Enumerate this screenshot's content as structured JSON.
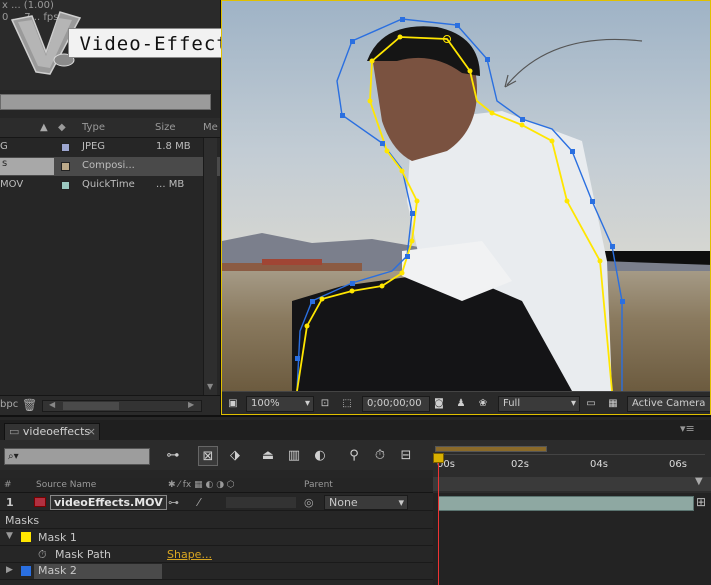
{
  "project_panel": {
    "info_lines": [
      "x ... (1.00)",
      "0 ... 7... fps"
    ],
    "columns": {
      "type": "Type",
      "size": "Size",
      "media": "Me"
    },
    "rows": [
      {
        "name": "G",
        "type": "JPEG",
        "size": "1.8 MB",
        "swatch": "#9da6cf",
        "selected": false
      },
      {
        "name": "s",
        "type": "Composi...",
        "size": "",
        "swatch": "#bca989",
        "selected": true
      },
      {
        "name": "MOV",
        "type": "QuickTime",
        "size": "... MB",
        "swatch": "#9bc7c0",
        "selected": false
      }
    ],
    "bottom_label": "bpc"
  },
  "logo": {
    "text": "Video-Effects.Ir"
  },
  "viewer": {
    "zoom": "100%",
    "timecode": "0;00;00;00",
    "resolution": "Full",
    "camera": "Active Camera"
  },
  "timeline": {
    "tab_label": "videoeffects",
    "search_placeholder": "⌕▾",
    "ruler_labels": [
      "00s",
      "02s",
      "04s",
      "06s"
    ],
    "columns": {
      "num": "#",
      "source": "Source Name",
      "parent": "Parent"
    },
    "layer": {
      "index": "1",
      "name": "videoEffects.MOV",
      "parent": "None"
    },
    "masks_label": "Masks",
    "mask1": "Mask 1",
    "mask_path": "Mask Path",
    "mask_path_value": "Shape...",
    "mask2": "Mask 2"
  },
  "colors": {
    "mask1_color": "#ffe600",
    "mask2_color": "#2a6fe0",
    "accent": "#e0c000"
  }
}
